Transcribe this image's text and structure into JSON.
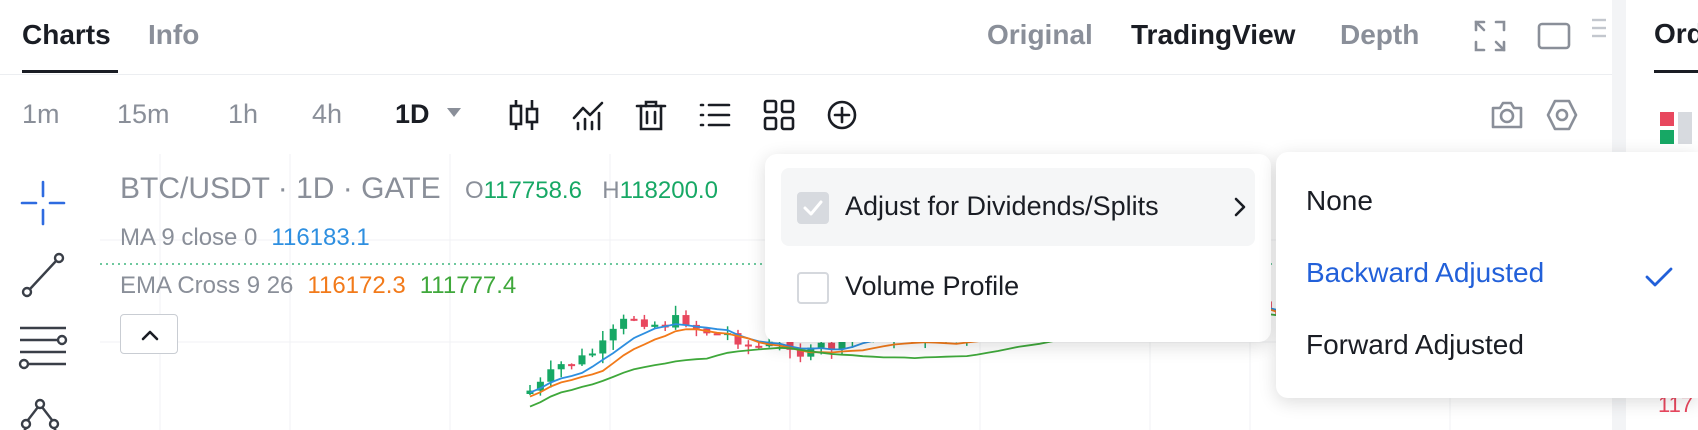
{
  "tabs": [
    {
      "label": "Charts",
      "active": true
    },
    {
      "label": "Info",
      "active": false
    }
  ],
  "views": [
    {
      "label": "Original",
      "active": false
    },
    {
      "label": "TradingView",
      "active": true
    },
    {
      "label": "Depth",
      "active": false
    }
  ],
  "top_icons": [
    "fullscreen-icon",
    "window-icon",
    "drag-handle-icon"
  ],
  "right_panel": {
    "tab": "Ord",
    "price": "117"
  },
  "timeframes": [
    {
      "label": "1m",
      "active": false
    },
    {
      "label": "15m",
      "active": false
    },
    {
      "label": "1h",
      "active": false
    },
    {
      "label": "4h",
      "active": false
    },
    {
      "label": "1D",
      "active": true
    }
  ],
  "toolbar_icons": [
    "candlestick-icon",
    "indicator-icon",
    "trash-icon",
    "list-icon",
    "grid-icon",
    "plus-circle-icon",
    "camera-icon",
    "settings-icon"
  ],
  "left_tools": [
    "crosshair-icon",
    "trend-line-icon",
    "fib-lines-icon",
    "pattern-icon"
  ],
  "legend": {
    "pair": "BTC/USDT · 1D · GATE",
    "o_label": "O",
    "o_value": "117758.6",
    "h_label": "H",
    "h_value": "118200.0",
    "ma_label": "MA 9 close 0",
    "ma_value": "116183.1",
    "ema_label": "EMA Cross 9 26",
    "ema_value1": "116172.3",
    "ema_value2": "111777.4"
  },
  "menu": {
    "items": [
      {
        "label": "Adjust for Dividends/Splits",
        "checked": true,
        "has_submenu": true
      },
      {
        "label": "Volume Profile",
        "checked": false,
        "has_submenu": false
      }
    ]
  },
  "submenu": {
    "options": [
      {
        "label": "None",
        "selected": false
      },
      {
        "label": "Backward Adjusted",
        "selected": true
      },
      {
        "label": "Forward Adjusted",
        "selected": false
      }
    ]
  },
  "colors": {
    "up": "#17a865",
    "down": "#e8475e",
    "ma": "#2e8fe0",
    "ema_fast": "#f27a1a",
    "ema_slow": "#3fa83b",
    "accent": "#2260d9"
  }
}
